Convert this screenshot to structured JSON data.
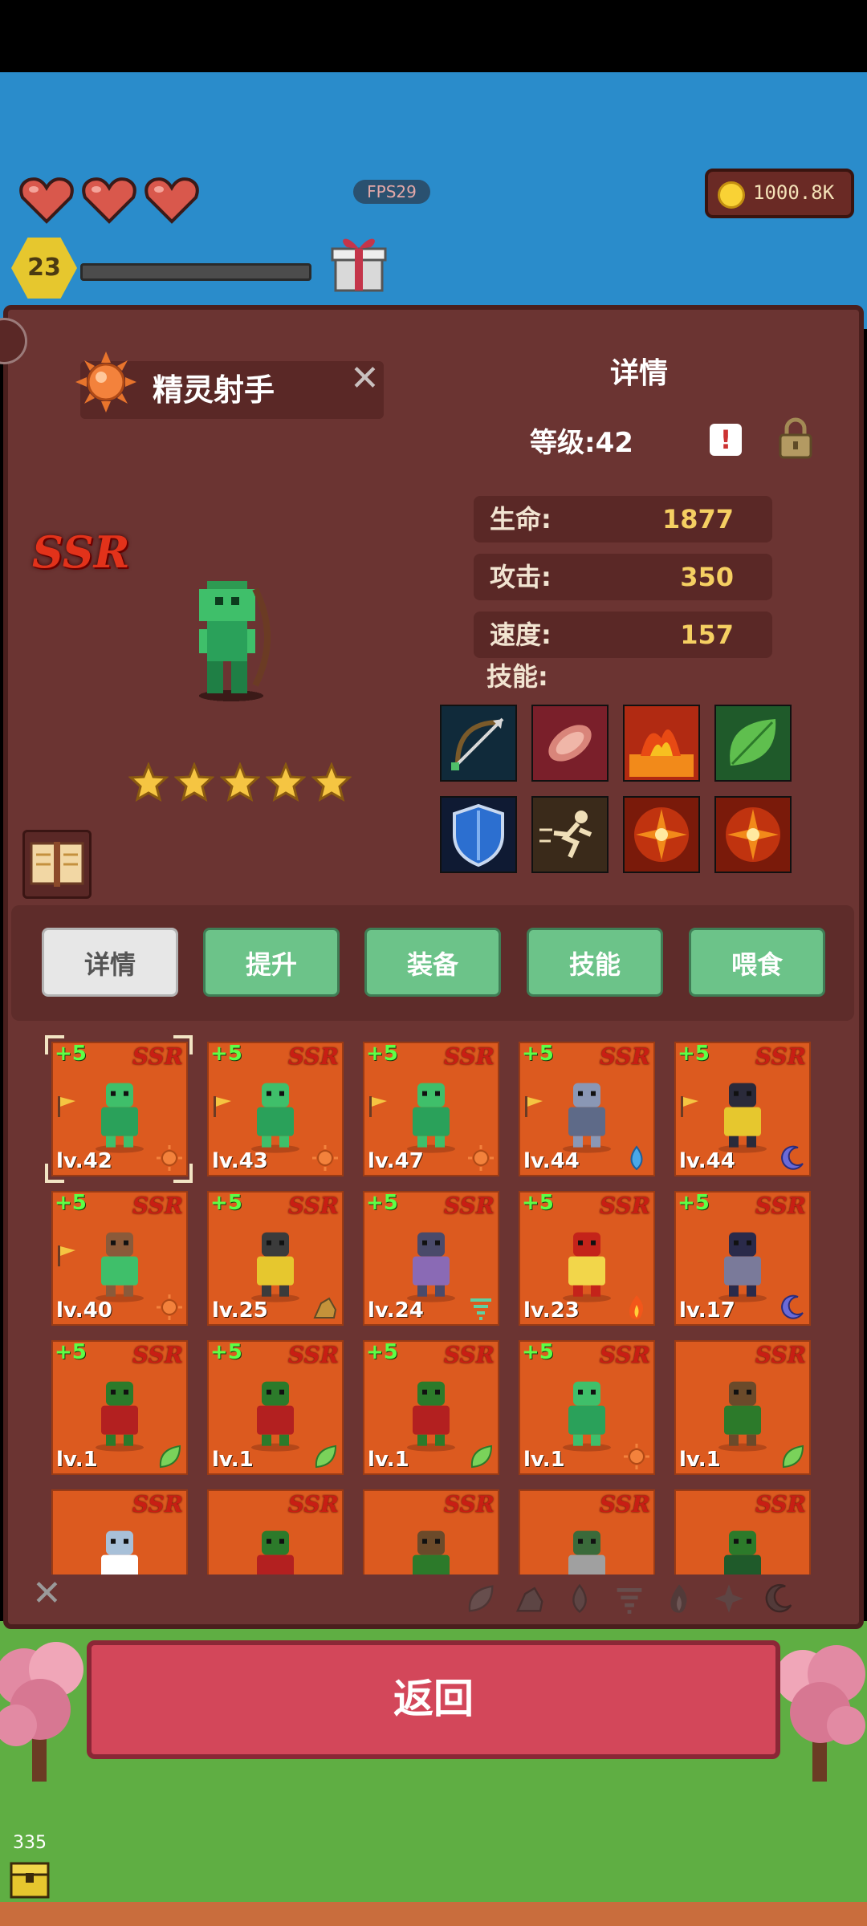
{
  "hud": {
    "hearts": 3,
    "fps": "FPS29",
    "coins": "1000.8K",
    "player_level": "23",
    "xp_progress": 0.0
  },
  "panel": {
    "hero_name": "精灵射手",
    "details_title": "详情",
    "level_text": "等级:42",
    "rarity": "SSR",
    "star_count": 5,
    "stats": [
      {
        "label": "生命:",
        "value": "1877"
      },
      {
        "label": "攻击:",
        "value": "350"
      },
      {
        "label": "速度:",
        "value": "157"
      }
    ],
    "skills_label": "技能:",
    "skill_icons": [
      "bow-arrow-icon",
      "meat-icon",
      "fire-icon",
      "leaf-icon",
      "shield-icon",
      "dash-icon",
      "burst-icon",
      "burst-icon"
    ]
  },
  "tabs": [
    {
      "label": "详情",
      "active": true
    },
    {
      "label": "提升",
      "active": false
    },
    {
      "label": "装备",
      "active": false
    },
    {
      "label": "技能",
      "active": false
    },
    {
      "label": "喂食",
      "active": false
    }
  ],
  "cards": [
    {
      "plus": "+5",
      "rarity": "SSR",
      "level": "lv.42",
      "element": "sun",
      "flag": true,
      "selected": true,
      "sprite": "green-archer"
    },
    {
      "plus": "+5",
      "rarity": "SSR",
      "level": "lv.43",
      "element": "sun",
      "flag": true,
      "selected": false,
      "sprite": "green-archer"
    },
    {
      "plus": "+5",
      "rarity": "SSR",
      "level": "lv.47",
      "element": "sun",
      "flag": true,
      "selected": false,
      "sprite": "green-archer"
    },
    {
      "plus": "+5",
      "rarity": "SSR",
      "level": "lv.44",
      "element": "water",
      "flag": true,
      "selected": false,
      "sprite": "grey-knight"
    },
    {
      "plus": "+5",
      "rarity": "SSR",
      "level": "lv.44",
      "element": "moon",
      "flag": true,
      "selected": false,
      "sprite": "dark-armor"
    },
    {
      "plus": "+5",
      "rarity": "SSR",
      "level": "lv.40",
      "element": "sun",
      "flag": true,
      "selected": false,
      "sprite": "centaur"
    },
    {
      "plus": "+5",
      "rarity": "SSR",
      "level": "lv.25",
      "element": "earth",
      "flag": false,
      "selected": false,
      "sprite": "golem"
    },
    {
      "plus": "+5",
      "rarity": "SSR",
      "level": "lv.24",
      "element": "wind",
      "flag": false,
      "selected": false,
      "sprite": "reaper"
    },
    {
      "plus": "+5",
      "rarity": "SSR",
      "level": "lv.23",
      "element": "fire",
      "flag": false,
      "selected": false,
      "sprite": "red-demon"
    },
    {
      "plus": "+5",
      "rarity": "SSR",
      "level": "lv.17",
      "element": "moon",
      "flag": false,
      "selected": false,
      "sprite": "dark-knight"
    },
    {
      "plus": "+5",
      "rarity": "SSR",
      "level": "lv.1",
      "element": "leaf",
      "flag": false,
      "selected": false,
      "sprite": "orc-axe"
    },
    {
      "plus": "+5",
      "rarity": "SSR",
      "level": "lv.1",
      "element": "leaf",
      "flag": false,
      "selected": false,
      "sprite": "orc-axe"
    },
    {
      "plus": "+5",
      "rarity": "SSR",
      "level": "lv.1",
      "element": "leaf",
      "flag": false,
      "selected": false,
      "sprite": "orc-axe"
    },
    {
      "plus": "+5",
      "rarity": "SSR",
      "level": "lv.1",
      "element": "sun",
      "flag": false,
      "selected": false,
      "sprite": "green-archer"
    },
    {
      "plus": "",
      "rarity": "SSR",
      "level": "lv.1",
      "element": "leaf",
      "flag": false,
      "selected": false,
      "sprite": "treant"
    },
    {
      "plus": "",
      "rarity": "SSR",
      "level": "",
      "element": "",
      "flag": false,
      "selected": false,
      "sprite": "cat"
    },
    {
      "plus": "",
      "rarity": "SSR",
      "level": "",
      "element": "",
      "flag": false,
      "selected": false,
      "sprite": "orc-axe"
    },
    {
      "plus": "",
      "rarity": "SSR",
      "level": "",
      "element": "",
      "flag": false,
      "selected": false,
      "sprite": "treant"
    },
    {
      "plus": "",
      "rarity": "SSR",
      "level": "",
      "element": "",
      "flag": false,
      "selected": false,
      "sprite": "orc-sword"
    },
    {
      "plus": "",
      "rarity": "SSR",
      "level": "",
      "element": "",
      "flag": false,
      "selected": false,
      "sprite": "goblin"
    }
  ],
  "filters": [
    "leaf",
    "earth",
    "water",
    "wind",
    "fire",
    "burst",
    "moon"
  ],
  "return_label": "返回",
  "bottom_counter": "335",
  "colors": {
    "panel": "#6b3432",
    "card": "#dc5a1f",
    "tab_green": "#6cc389",
    "return_red": "#d3475a",
    "gold_text": "#f5cf62"
  }
}
